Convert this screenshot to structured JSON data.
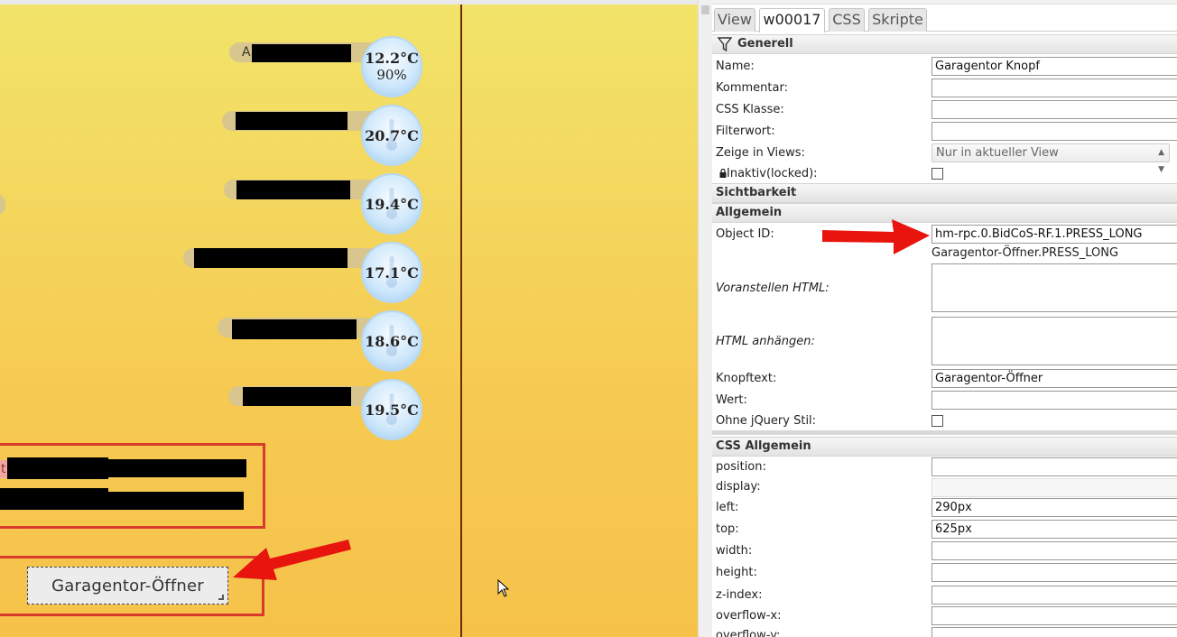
{
  "canvas": {
    "widgets": [
      {
        "label_prefix": "A",
        "temperature": "12.2°C",
        "humidity": "90%"
      },
      {
        "temperature": "20.7°C"
      },
      {
        "temperature": "19.4°C"
      },
      {
        "temperature": "17.1°C"
      },
      {
        "temperature": "18.6°C"
      },
      {
        "temperature": "19.5°C"
      }
    ],
    "partial_label": "t",
    "garage_button": "Garagentor-Öffner"
  },
  "panel": {
    "tabs": [
      "View",
      "w00017",
      "CSS",
      "Skripte"
    ],
    "sections": {
      "generell": "Generell",
      "sichtbarkeit": "Sichtbarkeit",
      "allgemein": "Allgemein",
      "css_allgemein": "CSS Allgemein"
    },
    "generell": {
      "name_label": "Name:",
      "name_value": "Garagentor Knopf",
      "kommentar_label": "Kommentar:",
      "css_klasse_label": "CSS Klasse:",
      "filterwort_label": "Filterwort:",
      "zeige_label": "Zeige in Views:",
      "zeige_value": "Nur in aktueller View",
      "inaktiv_label": "Inaktiv(locked):"
    },
    "allgemein": {
      "object_id_label": "Object ID:",
      "object_id_value": "hm-rpc.0.BidCoS-RF.1.PRESS_LONG",
      "object_id_hint": "Garagentor-Öffner.PRESS_LONG",
      "voranstellen_label": "Voranstellen HTML:",
      "anhaengen_label": "HTML anhängen:",
      "knopftext_label": "Knopftext:",
      "knopftext_value": "Garagentor-Öffner",
      "wert_label": "Wert:",
      "ohne_jquery_label": "Ohne jQuery Stil:"
    },
    "css": {
      "position_label": "position:",
      "display_label": "display:",
      "left_label": "left:",
      "left_value": "290px",
      "top_label": "top:",
      "top_value": "625px",
      "width_label": "width:",
      "height_label": "height:",
      "zindex_label": "z-index:",
      "overflowx_label": "overflow-x:",
      "overflowy_label": "overflow-y:"
    }
  },
  "colors": {
    "annotation_red": "#e8150f",
    "highlight_box": "#d93a2b",
    "divider": "#6b2a0e"
  }
}
